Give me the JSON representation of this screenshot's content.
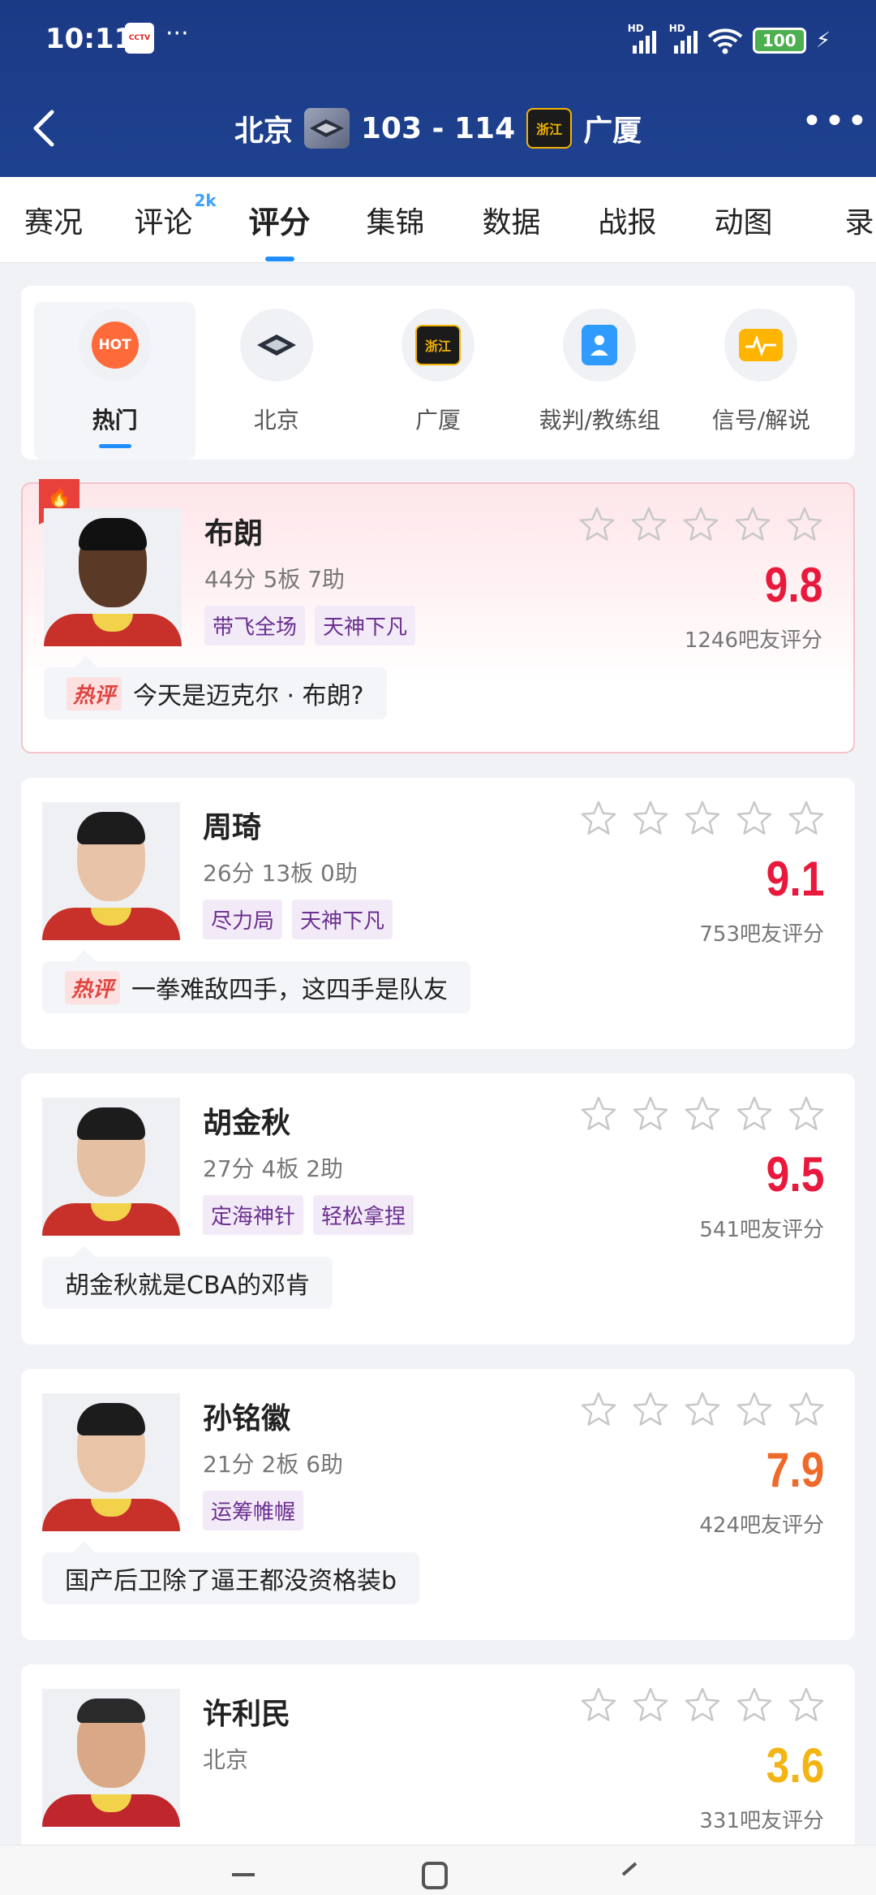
{
  "status_bar": {
    "time": "10:11",
    "dots": "···",
    "battery": "100",
    "hd1": "HD",
    "hd2": "HD",
    "app_badge": "CCTV"
  },
  "header": {
    "home_team": "北京",
    "away_team": "广厦",
    "score": "103 - 114",
    "away_logo_text": "浙江"
  },
  "tabs": [
    {
      "label": "赛况"
    },
    {
      "label": "评论",
      "sup": "2k"
    },
    {
      "label": "评分"
    },
    {
      "label": "集锦"
    },
    {
      "label": "数据"
    },
    {
      "label": "战报"
    },
    {
      "label": "动图"
    },
    {
      "label": "录"
    }
  ],
  "categories": [
    {
      "label": "热门",
      "icon_text": "HOT"
    },
    {
      "label": "北京"
    },
    {
      "label": "广厦",
      "icon_text": "浙江"
    },
    {
      "label": "裁判/教练组"
    },
    {
      "label": "信号/解说"
    }
  ],
  "players": [
    {
      "name": "布朗",
      "stat": "44分 5板 7助",
      "tags": [
        "带飞全场",
        "天神下凡"
      ],
      "rating": "9.8",
      "rating_color": "#e8193c",
      "raters": "1246吧友评分",
      "comment": "今天是迈克尔 · 布朗?",
      "hot_label": "热评"
    },
    {
      "name": "周琦",
      "stat": "26分 13板 0助",
      "tags": [
        "尽力局",
        "天神下凡"
      ],
      "rating": "9.1",
      "rating_color": "#e8193c",
      "raters": "753吧友评分",
      "comment": "一拳难敌四手，这四手是队友",
      "hot_label": "热评"
    },
    {
      "name": "胡金秋",
      "stat": "27分 4板 2助",
      "tags": [
        "定海神针",
        "轻松拿捏"
      ],
      "rating": "9.5",
      "rating_color": "#e8193c",
      "raters": "541吧友评分",
      "comment": "胡金秋就是CBA的邓肯"
    },
    {
      "name": "孙铭徽",
      "stat": "21分 2板 6助",
      "tags": [
        "运筹帷幄"
      ],
      "rating": "7.9",
      "rating_color": "#ef6a2a",
      "raters": "424吧友评分",
      "comment": "国产后卫除了逼王都没资格装b"
    },
    {
      "name": "许利民",
      "stat": "北京",
      "tags": [],
      "rating": "3.6",
      "rating_color": "#f3b414",
      "raters": "331吧友评分"
    }
  ]
}
